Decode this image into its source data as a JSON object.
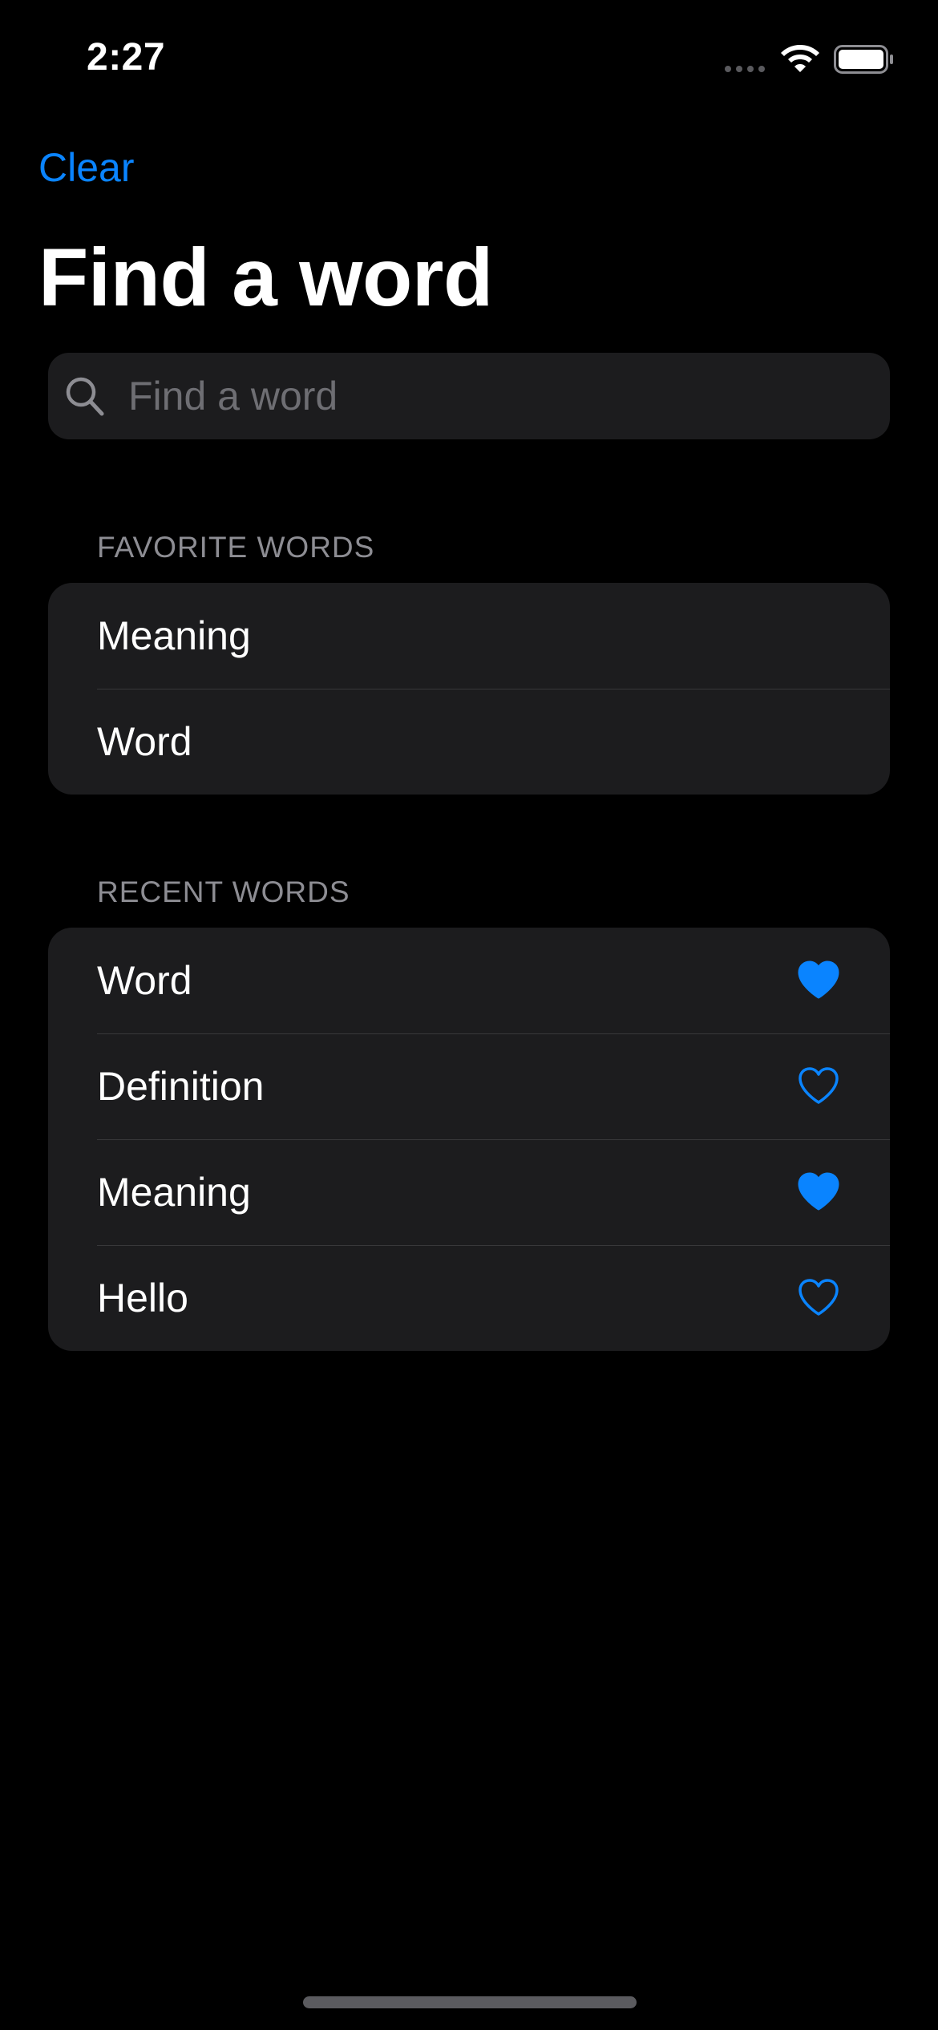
{
  "status_bar": {
    "time": "2:27",
    "icons": [
      "signal-dots-icon",
      "wifi-icon",
      "battery-icon"
    ]
  },
  "nav": {
    "clear_label": "Clear",
    "title": "Find a word"
  },
  "search": {
    "placeholder": "Find a word",
    "value": "",
    "icon": "search-icon"
  },
  "favorites": {
    "header": "FAVORITE WORDS",
    "items": [
      {
        "label": "Meaning"
      },
      {
        "label": "Word"
      }
    ]
  },
  "recent": {
    "header": "RECENT WORDS",
    "items": [
      {
        "label": "Word",
        "favorited": true
      },
      {
        "label": "Definition",
        "favorited": false
      },
      {
        "label": "Meaning",
        "favorited": true
      },
      {
        "label": "Hello",
        "favorited": false
      }
    ]
  },
  "colors": {
    "background": "#000000",
    "card": "#1c1c1e",
    "accent": "#0a84ff",
    "secondary_text": "#8d8d93",
    "separator": "#38383a"
  }
}
